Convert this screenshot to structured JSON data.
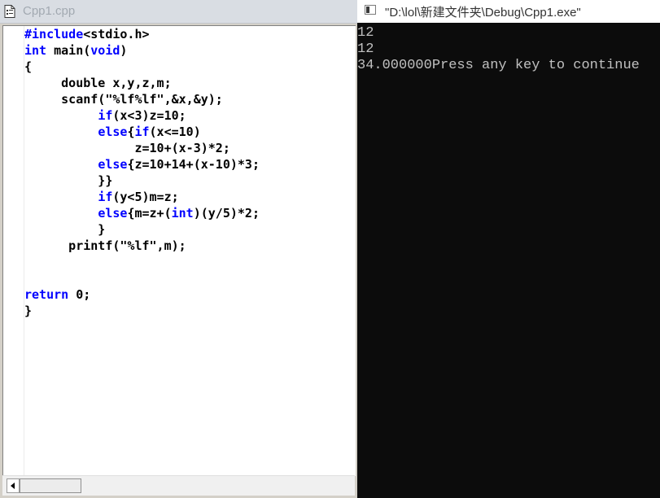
{
  "editor": {
    "title": "Cpp1.cpp",
    "icon": "document-icon",
    "code_lines": [
      [
        {
          "t": "#include",
          "k": 1
        },
        {
          "t": "<stdio.h>",
          "k": 0
        }
      ],
      [
        {
          "t": "int",
          "k": 1
        },
        {
          "t": " main(",
          "k": 0
        },
        {
          "t": "void",
          "k": 1
        },
        {
          "t": ")",
          "k": 0
        }
      ],
      [
        {
          "t": "{",
          "k": 0
        }
      ],
      [
        {
          "t": "     double x,y,z,m;",
          "k": 0
        }
      ],
      [
        {
          "t": "     scanf(\"%lf%lf\",&x,&y);",
          "k": 0
        }
      ],
      [
        {
          "t": "          ",
          "k": 0
        },
        {
          "t": "if",
          "k": 1
        },
        {
          "t": "(x<3)z=10;",
          "k": 0
        }
      ],
      [
        {
          "t": "          ",
          "k": 0
        },
        {
          "t": "else",
          "k": 1
        },
        {
          "t": "{",
          "k": 0
        },
        {
          "t": "if",
          "k": 1
        },
        {
          "t": "(x<=10)",
          "k": 0
        }
      ],
      [
        {
          "t": "               z=10+(x-3)*2;",
          "k": 0
        }
      ],
      [
        {
          "t": "          ",
          "k": 0
        },
        {
          "t": "else",
          "k": 1
        },
        {
          "t": "{z=10+14+(x-10)*3;",
          "k": 0
        }
      ],
      [
        {
          "t": "          }}",
          "k": 0
        }
      ],
      [
        {
          "t": "          ",
          "k": 0
        },
        {
          "t": "if",
          "k": 1
        },
        {
          "t": "(y<5)m=z;",
          "k": 0
        }
      ],
      [
        {
          "t": "          ",
          "k": 0
        },
        {
          "t": "else",
          "k": 1
        },
        {
          "t": "{m=z+(",
          "k": 0
        },
        {
          "t": "int",
          "k": 1
        },
        {
          "t": ")(y/5)*2;",
          "k": 0
        }
      ],
      [
        {
          "t": "          }",
          "k": 0
        }
      ],
      [
        {
          "t": "      printf(\"%lf\",m);",
          "k": 0
        }
      ],
      [
        {
          "t": "",
          "k": 0
        }
      ],
      [
        {
          "t": "",
          "k": 0
        }
      ],
      [
        {
          "t": "return",
          "k": 1
        },
        {
          "t": " 0;",
          "k": 0
        }
      ],
      [
        {
          "t": "}",
          "k": 0
        }
      ]
    ],
    "keyword_color": "#0000ff",
    "text_color": "#000000"
  },
  "console": {
    "title": "\"D:\\lol\\新建文件夹\\Debug\\Cpp1.exe\"",
    "icon": "console-window-icon",
    "lines": [
      "12",
      "12",
      "34.000000Press any key to continue"
    ],
    "text_color": "#c0c0c0",
    "background": "#0c0c0c"
  }
}
